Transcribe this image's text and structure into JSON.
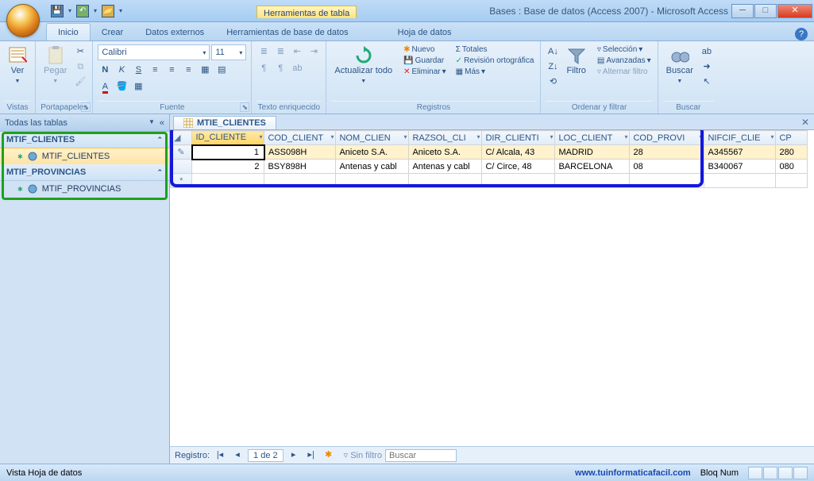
{
  "window": {
    "contextual_label": "Herramientas de tabla",
    "title": "Bases : Base de datos (Access 2007) - Microsoft Access"
  },
  "ribbon_tabs": {
    "t0": "Inicio",
    "t1": "Crear",
    "t2": "Datos externos",
    "t3": "Herramientas de base de datos",
    "t4": "Hoja de datos"
  },
  "ribbon": {
    "vistas": {
      "ver": "Ver",
      "label": "Vistas"
    },
    "porta": {
      "pegar": "Pegar",
      "label": "Portapapeles"
    },
    "fuente": {
      "name": "Calibri",
      "size": "11",
      "label": "Fuente"
    },
    "texto": {
      "label": "Texto enriquecido"
    },
    "reg": {
      "actualizar": "Actualizar todo",
      "nuevo": "Nuevo",
      "guardar": "Guardar",
      "eliminar": "Eliminar",
      "totales": "Totales",
      "ortografia": "Revisión ortográfica",
      "mas": "Más",
      "label": "Registros"
    },
    "ordenar": {
      "filtro": "Filtro",
      "seleccion": "Selección",
      "avanzadas": "Avanzadas",
      "alternar": "Alternar filtro",
      "label": "Ordenar y filtrar"
    },
    "buscar": {
      "buscar": "Buscar",
      "label": "Buscar"
    }
  },
  "nav": {
    "header": "Todas las tablas",
    "g1": "MTIF_CLIENTES",
    "g1_item": "MTIF_CLIENTES",
    "g2": "MTIF_PROVINCIAS",
    "g2_item": "MTIF_PROVINCIAS"
  },
  "tab": {
    "name": "MTIE_CLIENTES"
  },
  "table": {
    "headers": {
      "h0": "ID_CLIENTE",
      "h1": "COD_CLIENT",
      "h2": "NOM_CLIEN",
      "h3": "RAZSOL_CLI",
      "h4": "DIR_CLIENTI",
      "h5": "LOC_CLIENT",
      "h6": "COD_PROVI",
      "h7": "NIFCIF_CLIE",
      "h8": "CP"
    },
    "rows": [
      {
        "id": "1",
        "cod": "ASS098H",
        "nom": "Aniceto S.A.",
        "raz": "Aniceto S.A.",
        "dir": "C/ Alcala, 43",
        "loc": "MADRID",
        "prov": "28",
        "nif": "A345567",
        "cp": "280"
      },
      {
        "id": "2",
        "cod": "BSY898H",
        "nom": "Antenas y cabl",
        "raz": "Antenas y cabl",
        "dir": "C/ Circe, 48",
        "loc": "BARCELONA",
        "prov": "08",
        "nif": "B340067",
        "cp": "080"
      }
    ]
  },
  "recordnav": {
    "label": "Registro:",
    "pos": "1 de 2",
    "filter": "Sin filtro",
    "search": "Buscar"
  },
  "status": {
    "view": "Vista Hoja de datos",
    "url": "www.tuinformaticafacil.com",
    "bloqnum": "Bloq Num"
  }
}
